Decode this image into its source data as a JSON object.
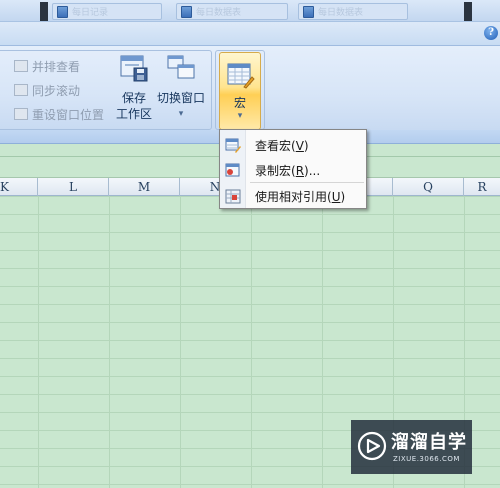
{
  "title_tabs": [
    {
      "label": "每日记录",
      "left": 0
    },
    {
      "label": "每日数据表",
      "left": 0
    },
    {
      "label": "每日数据表",
      "left": 0
    }
  ],
  "help_label": "?",
  "ribbon": {
    "window_group": {
      "side_by_side": "并排查看",
      "sync_scroll": "同步滚动",
      "reset_position": "重设窗口位置",
      "save_workspace_line1": "保存",
      "save_workspace_line2": "工作区",
      "switch_windows": "切换窗口",
      "dropdown_arrow": "▾"
    },
    "macro_group": {
      "macros_label": "宏",
      "dropdown_arrow": "▾"
    }
  },
  "macro_menu": {
    "items": [
      {
        "label": "查看宏(",
        "key": "V",
        "suffix": ")",
        "icon": "view-macros-icon"
      },
      {
        "label": "录制宏(",
        "key": "R",
        "suffix": ")...",
        "icon": "record-macro-icon"
      },
      {
        "label": "使用相对引用(",
        "key": "U",
        "suffix": ")",
        "icon": "relative-reference-icon"
      }
    ]
  },
  "columns": [
    "K",
    "L",
    "M",
    "N",
    "O",
    "P",
    "Q",
    "R"
  ],
  "watermark": {
    "title": "溜溜自学",
    "subtitle": "ZIXUE.3066.COM"
  },
  "colors": {
    "sheet_background": "#c9e7cf",
    "ribbon_background": "#dce8f7",
    "macro_button_highlight": "#ffd96a"
  }
}
